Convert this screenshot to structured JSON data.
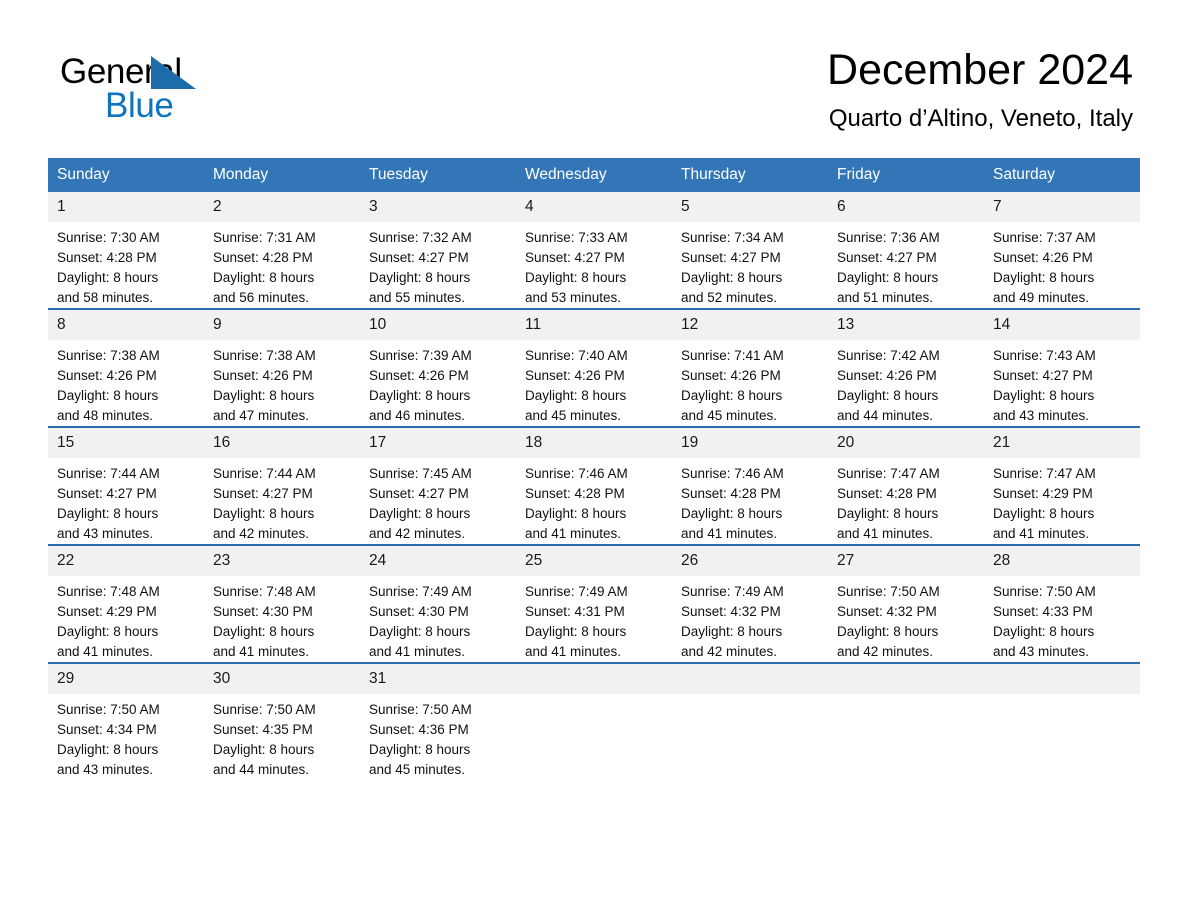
{
  "brand": {
    "name_part1": "General",
    "name_part2": "Blue",
    "triangle_icon": "blue-triangle-icon",
    "accent_color": "#0f74bd"
  },
  "header": {
    "month_title": "December 2024",
    "location": "Quarto d’Altino, Veneto, Italy"
  },
  "theme": {
    "header_row_bg": "#3276b8",
    "row_divider": "#2a6ead",
    "day_number_bg": "#f1f1f1"
  },
  "weekdays": [
    "Sunday",
    "Monday",
    "Tuesday",
    "Wednesday",
    "Thursday",
    "Friday",
    "Saturday"
  ],
  "weeks": [
    [
      {
        "day": "1",
        "info": "Sunrise: 7:30 AM\nSunset: 4:28 PM\nDaylight: 8 hours\nand 58 minutes."
      },
      {
        "day": "2",
        "info": "Sunrise: 7:31 AM\nSunset: 4:28 PM\nDaylight: 8 hours\nand 56 minutes."
      },
      {
        "day": "3",
        "info": "Sunrise: 7:32 AM\nSunset: 4:27 PM\nDaylight: 8 hours\nand 55 minutes."
      },
      {
        "day": "4",
        "info": "Sunrise: 7:33 AM\nSunset: 4:27 PM\nDaylight: 8 hours\nand 53 minutes."
      },
      {
        "day": "5",
        "info": "Sunrise: 7:34 AM\nSunset: 4:27 PM\nDaylight: 8 hours\nand 52 minutes."
      },
      {
        "day": "6",
        "info": "Sunrise: 7:36 AM\nSunset: 4:27 PM\nDaylight: 8 hours\nand 51 minutes."
      },
      {
        "day": "7",
        "info": "Sunrise: 7:37 AM\nSunset: 4:26 PM\nDaylight: 8 hours\nand 49 minutes."
      }
    ],
    [
      {
        "day": "8",
        "info": "Sunrise: 7:38 AM\nSunset: 4:26 PM\nDaylight: 8 hours\nand 48 minutes."
      },
      {
        "day": "9",
        "info": "Sunrise: 7:38 AM\nSunset: 4:26 PM\nDaylight: 8 hours\nand 47 minutes."
      },
      {
        "day": "10",
        "info": "Sunrise: 7:39 AM\nSunset: 4:26 PM\nDaylight: 8 hours\nand 46 minutes."
      },
      {
        "day": "11",
        "info": "Sunrise: 7:40 AM\nSunset: 4:26 PM\nDaylight: 8 hours\nand 45 minutes."
      },
      {
        "day": "12",
        "info": "Sunrise: 7:41 AM\nSunset: 4:26 PM\nDaylight: 8 hours\nand 45 minutes."
      },
      {
        "day": "13",
        "info": "Sunrise: 7:42 AM\nSunset: 4:26 PM\nDaylight: 8 hours\nand 44 minutes."
      },
      {
        "day": "14",
        "info": "Sunrise: 7:43 AM\nSunset: 4:27 PM\nDaylight: 8 hours\nand 43 minutes."
      }
    ],
    [
      {
        "day": "15",
        "info": "Sunrise: 7:44 AM\nSunset: 4:27 PM\nDaylight: 8 hours\nand 43 minutes."
      },
      {
        "day": "16",
        "info": "Sunrise: 7:44 AM\nSunset: 4:27 PM\nDaylight: 8 hours\nand 42 minutes."
      },
      {
        "day": "17",
        "info": "Sunrise: 7:45 AM\nSunset: 4:27 PM\nDaylight: 8 hours\nand 42 minutes."
      },
      {
        "day": "18",
        "info": "Sunrise: 7:46 AM\nSunset: 4:28 PM\nDaylight: 8 hours\nand 41 minutes."
      },
      {
        "day": "19",
        "info": "Sunrise: 7:46 AM\nSunset: 4:28 PM\nDaylight: 8 hours\nand 41 minutes."
      },
      {
        "day": "20",
        "info": "Sunrise: 7:47 AM\nSunset: 4:28 PM\nDaylight: 8 hours\nand 41 minutes."
      },
      {
        "day": "21",
        "info": "Sunrise: 7:47 AM\nSunset: 4:29 PM\nDaylight: 8 hours\nand 41 minutes."
      }
    ],
    [
      {
        "day": "22",
        "info": "Sunrise: 7:48 AM\nSunset: 4:29 PM\nDaylight: 8 hours\nand 41 minutes."
      },
      {
        "day": "23",
        "info": "Sunrise: 7:48 AM\nSunset: 4:30 PM\nDaylight: 8 hours\nand 41 minutes."
      },
      {
        "day": "24",
        "info": "Sunrise: 7:49 AM\nSunset: 4:30 PM\nDaylight: 8 hours\nand 41 minutes."
      },
      {
        "day": "25",
        "info": "Sunrise: 7:49 AM\nSunset: 4:31 PM\nDaylight: 8 hours\nand 41 minutes."
      },
      {
        "day": "26",
        "info": "Sunrise: 7:49 AM\nSunset: 4:32 PM\nDaylight: 8 hours\nand 42 minutes."
      },
      {
        "day": "27",
        "info": "Sunrise: 7:50 AM\nSunset: 4:32 PM\nDaylight: 8 hours\nand 42 minutes."
      },
      {
        "day": "28",
        "info": "Sunrise: 7:50 AM\nSunset: 4:33 PM\nDaylight: 8 hours\nand 43 minutes."
      }
    ],
    [
      {
        "day": "29",
        "info": "Sunrise: 7:50 AM\nSunset: 4:34 PM\nDaylight: 8 hours\nand 43 minutes."
      },
      {
        "day": "30",
        "info": "Sunrise: 7:50 AM\nSunset: 4:35 PM\nDaylight: 8 hours\nand 44 minutes."
      },
      {
        "day": "31",
        "info": "Sunrise: 7:50 AM\nSunset: 4:36 PM\nDaylight: 8 hours\nand 45 minutes."
      },
      {
        "day": "",
        "info": ""
      },
      {
        "day": "",
        "info": ""
      },
      {
        "day": "",
        "info": ""
      },
      {
        "day": "",
        "info": ""
      }
    ]
  ]
}
